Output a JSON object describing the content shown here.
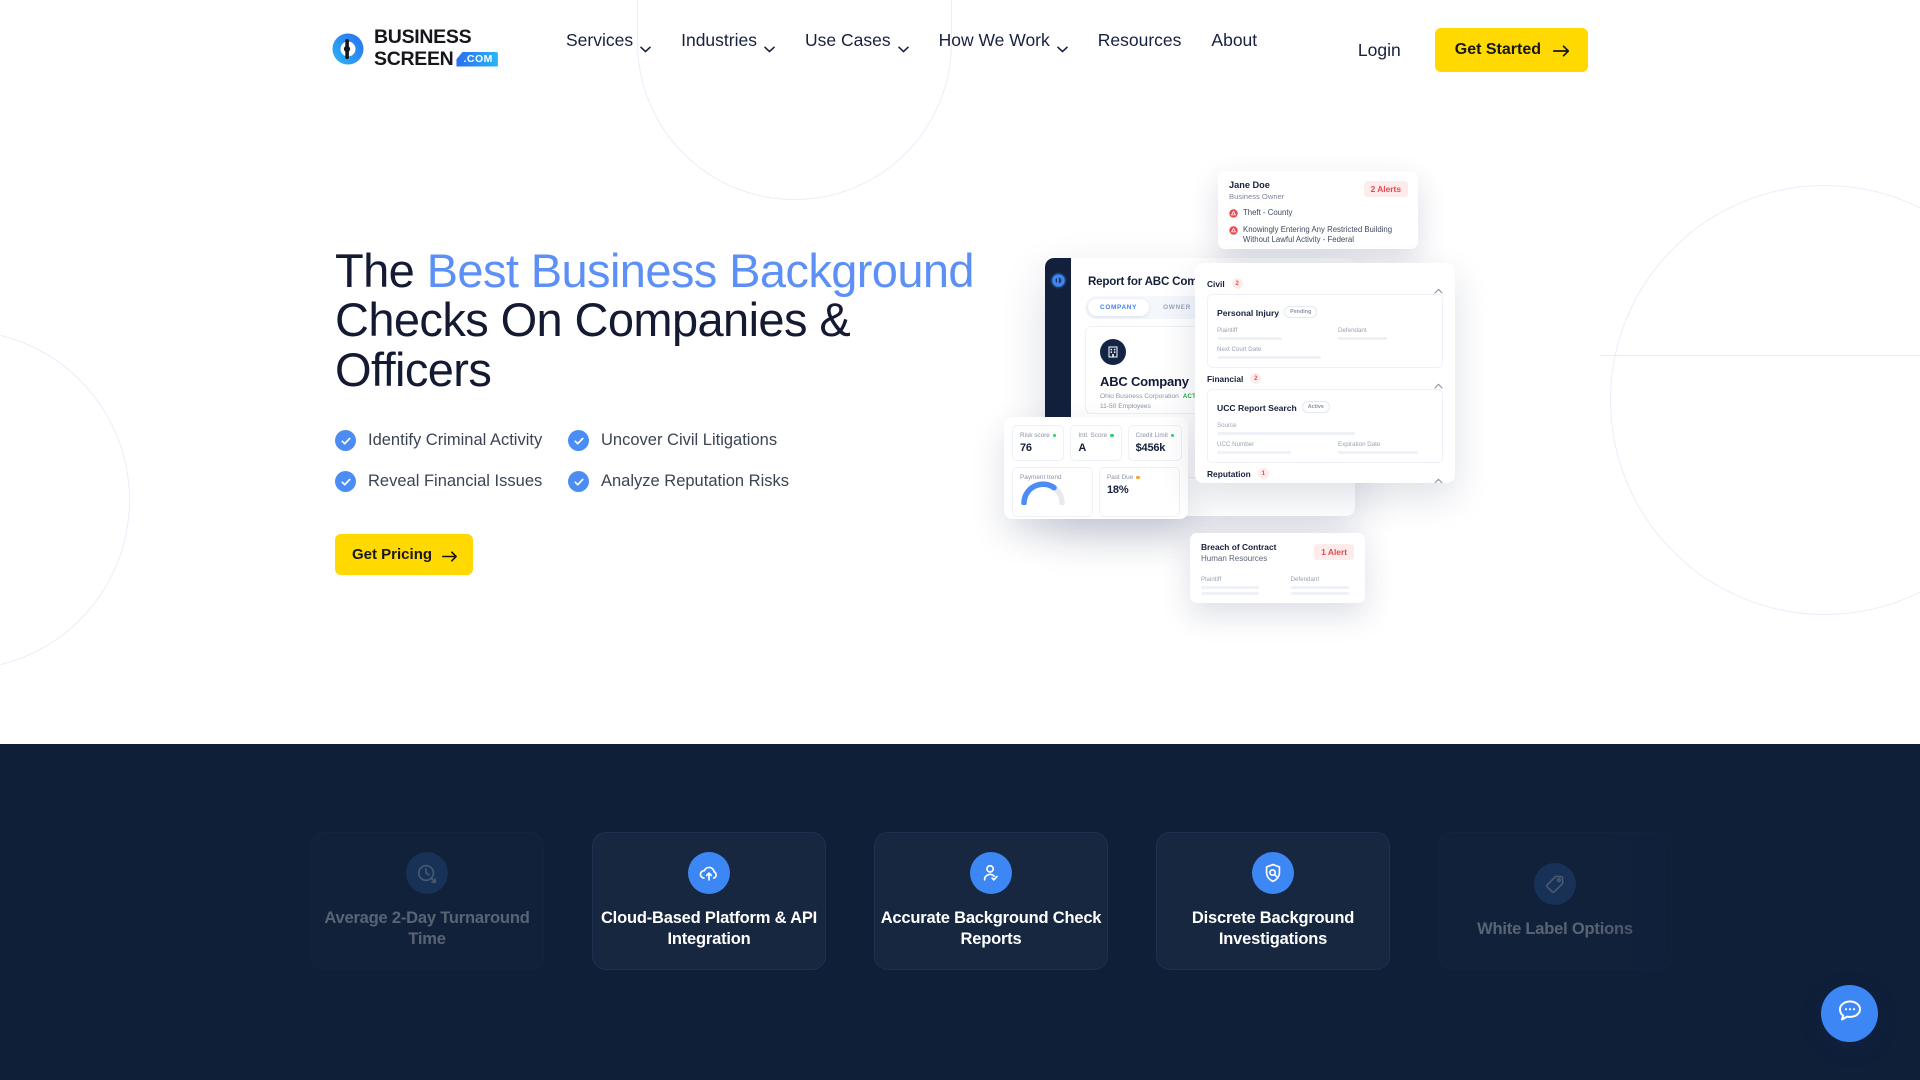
{
  "header": {
    "logo": {
      "line1": "BUSINESS",
      "line2": "SCREEN",
      "tld": ".COM",
      "icon": "business-screen-logo-icon"
    },
    "nav": [
      {
        "label": "Services",
        "has_dropdown": true
      },
      {
        "label": "Industries",
        "has_dropdown": true
      },
      {
        "label": "Use Cases",
        "has_dropdown": true
      },
      {
        "label": "How We Work",
        "has_dropdown": true
      },
      {
        "label": "Resources",
        "has_dropdown": false
      },
      {
        "label": "About",
        "has_dropdown": false
      }
    ],
    "login_label": "Login",
    "cta_label": "Get Started"
  },
  "hero": {
    "title_parts": [
      {
        "text": "The ",
        "highlight": false
      },
      {
        "text": "Best Business Background",
        "highlight": true
      },
      {
        "text": " Checks On Companies & Officers",
        "highlight": false
      }
    ],
    "title_plain": "The Best Business Background Checks On Companies & Officers",
    "highlight_color": "#5d90f7",
    "checks": [
      "Identify Criminal Activity",
      "Uncover Civil Litigations",
      "Reveal Financial Issues",
      "Analyze Reputation Risks"
    ],
    "cta_label": "Get Pricing"
  },
  "mock": {
    "report": {
      "title": "Report for ABC Company, Inc.",
      "tabs": [
        {
          "label": "COMPANY",
          "active": true
        },
        {
          "label": "OWNER",
          "active": false
        }
      ],
      "company_name": "ABC Company",
      "company_type": "Ohio Business Corporation",
      "company_status": "ACTIVE FILING",
      "company_employees": "11-50 Employees"
    },
    "metrics": [
      {
        "label": "Risk score",
        "value": "76",
        "dot_color": "#2ecc71"
      },
      {
        "label": "Intl. Score",
        "value": "A",
        "dot_color": "#2ecc71"
      },
      {
        "label": "Credit Limit",
        "value": "$456k",
        "dot_color": "#2ecc71"
      },
      {
        "label": "Payment trend",
        "value": "",
        "dot_color": ""
      },
      {
        "label": "Past Due",
        "value": "18%",
        "dot_color": "#f5a623"
      }
    ],
    "person_alert": {
      "name": "Jane Doe",
      "role": "Business Owner",
      "badge": "2 Alerts",
      "items": [
        "Theft - County",
        "Knowingly Entering Any Restricted Building Without Lawful Activity - Federal"
      ]
    },
    "panel_sections": [
      {
        "title": "Civil",
        "count": "2",
        "card_title": "Personal Injury",
        "card_pill": "Pending",
        "fields": [
          "Plaintiff",
          "Defendant",
          "Next Court Date"
        ]
      },
      {
        "title": "Financial",
        "count": "2",
        "card_title": "UCC Report Search",
        "card_pill": "Active",
        "fields": [
          "Source",
          "UCC Number",
          "Expiration Date"
        ]
      },
      {
        "title": "Reputation",
        "count": "1",
        "card_title": "",
        "card_pill": "",
        "fields": []
      }
    ],
    "breach": {
      "title": "Breach of Contract",
      "subtitle": "Human Resources",
      "badge": "1 Alert",
      "fields": [
        "Plaintiff",
        "Defendant"
      ]
    }
  },
  "features": {
    "cards": [
      {
        "label": "Average 2-Day Turnaround Time",
        "icon": "clock-arrow-icon",
        "faded": true
      },
      {
        "label": "Cloud-Based Platform & API Integration",
        "icon": "cloud-upload-icon",
        "faded": false
      },
      {
        "label": "Accurate Background Check Reports",
        "icon": "user-check-icon",
        "faded": false
      },
      {
        "label": "Discrete Background Investigations",
        "icon": "shield-search-icon",
        "faded": false
      },
      {
        "label": "White Label Options",
        "icon": "tag-icon",
        "faded": true
      }
    ]
  },
  "chat": {
    "icon": "chat-bubble-icon"
  },
  "colors": {
    "brand_blue": "#3d87f5",
    "accent_yellow": "#ffd900",
    "dark_navy": "#0f1f38",
    "alert_red": "#e5484d"
  }
}
